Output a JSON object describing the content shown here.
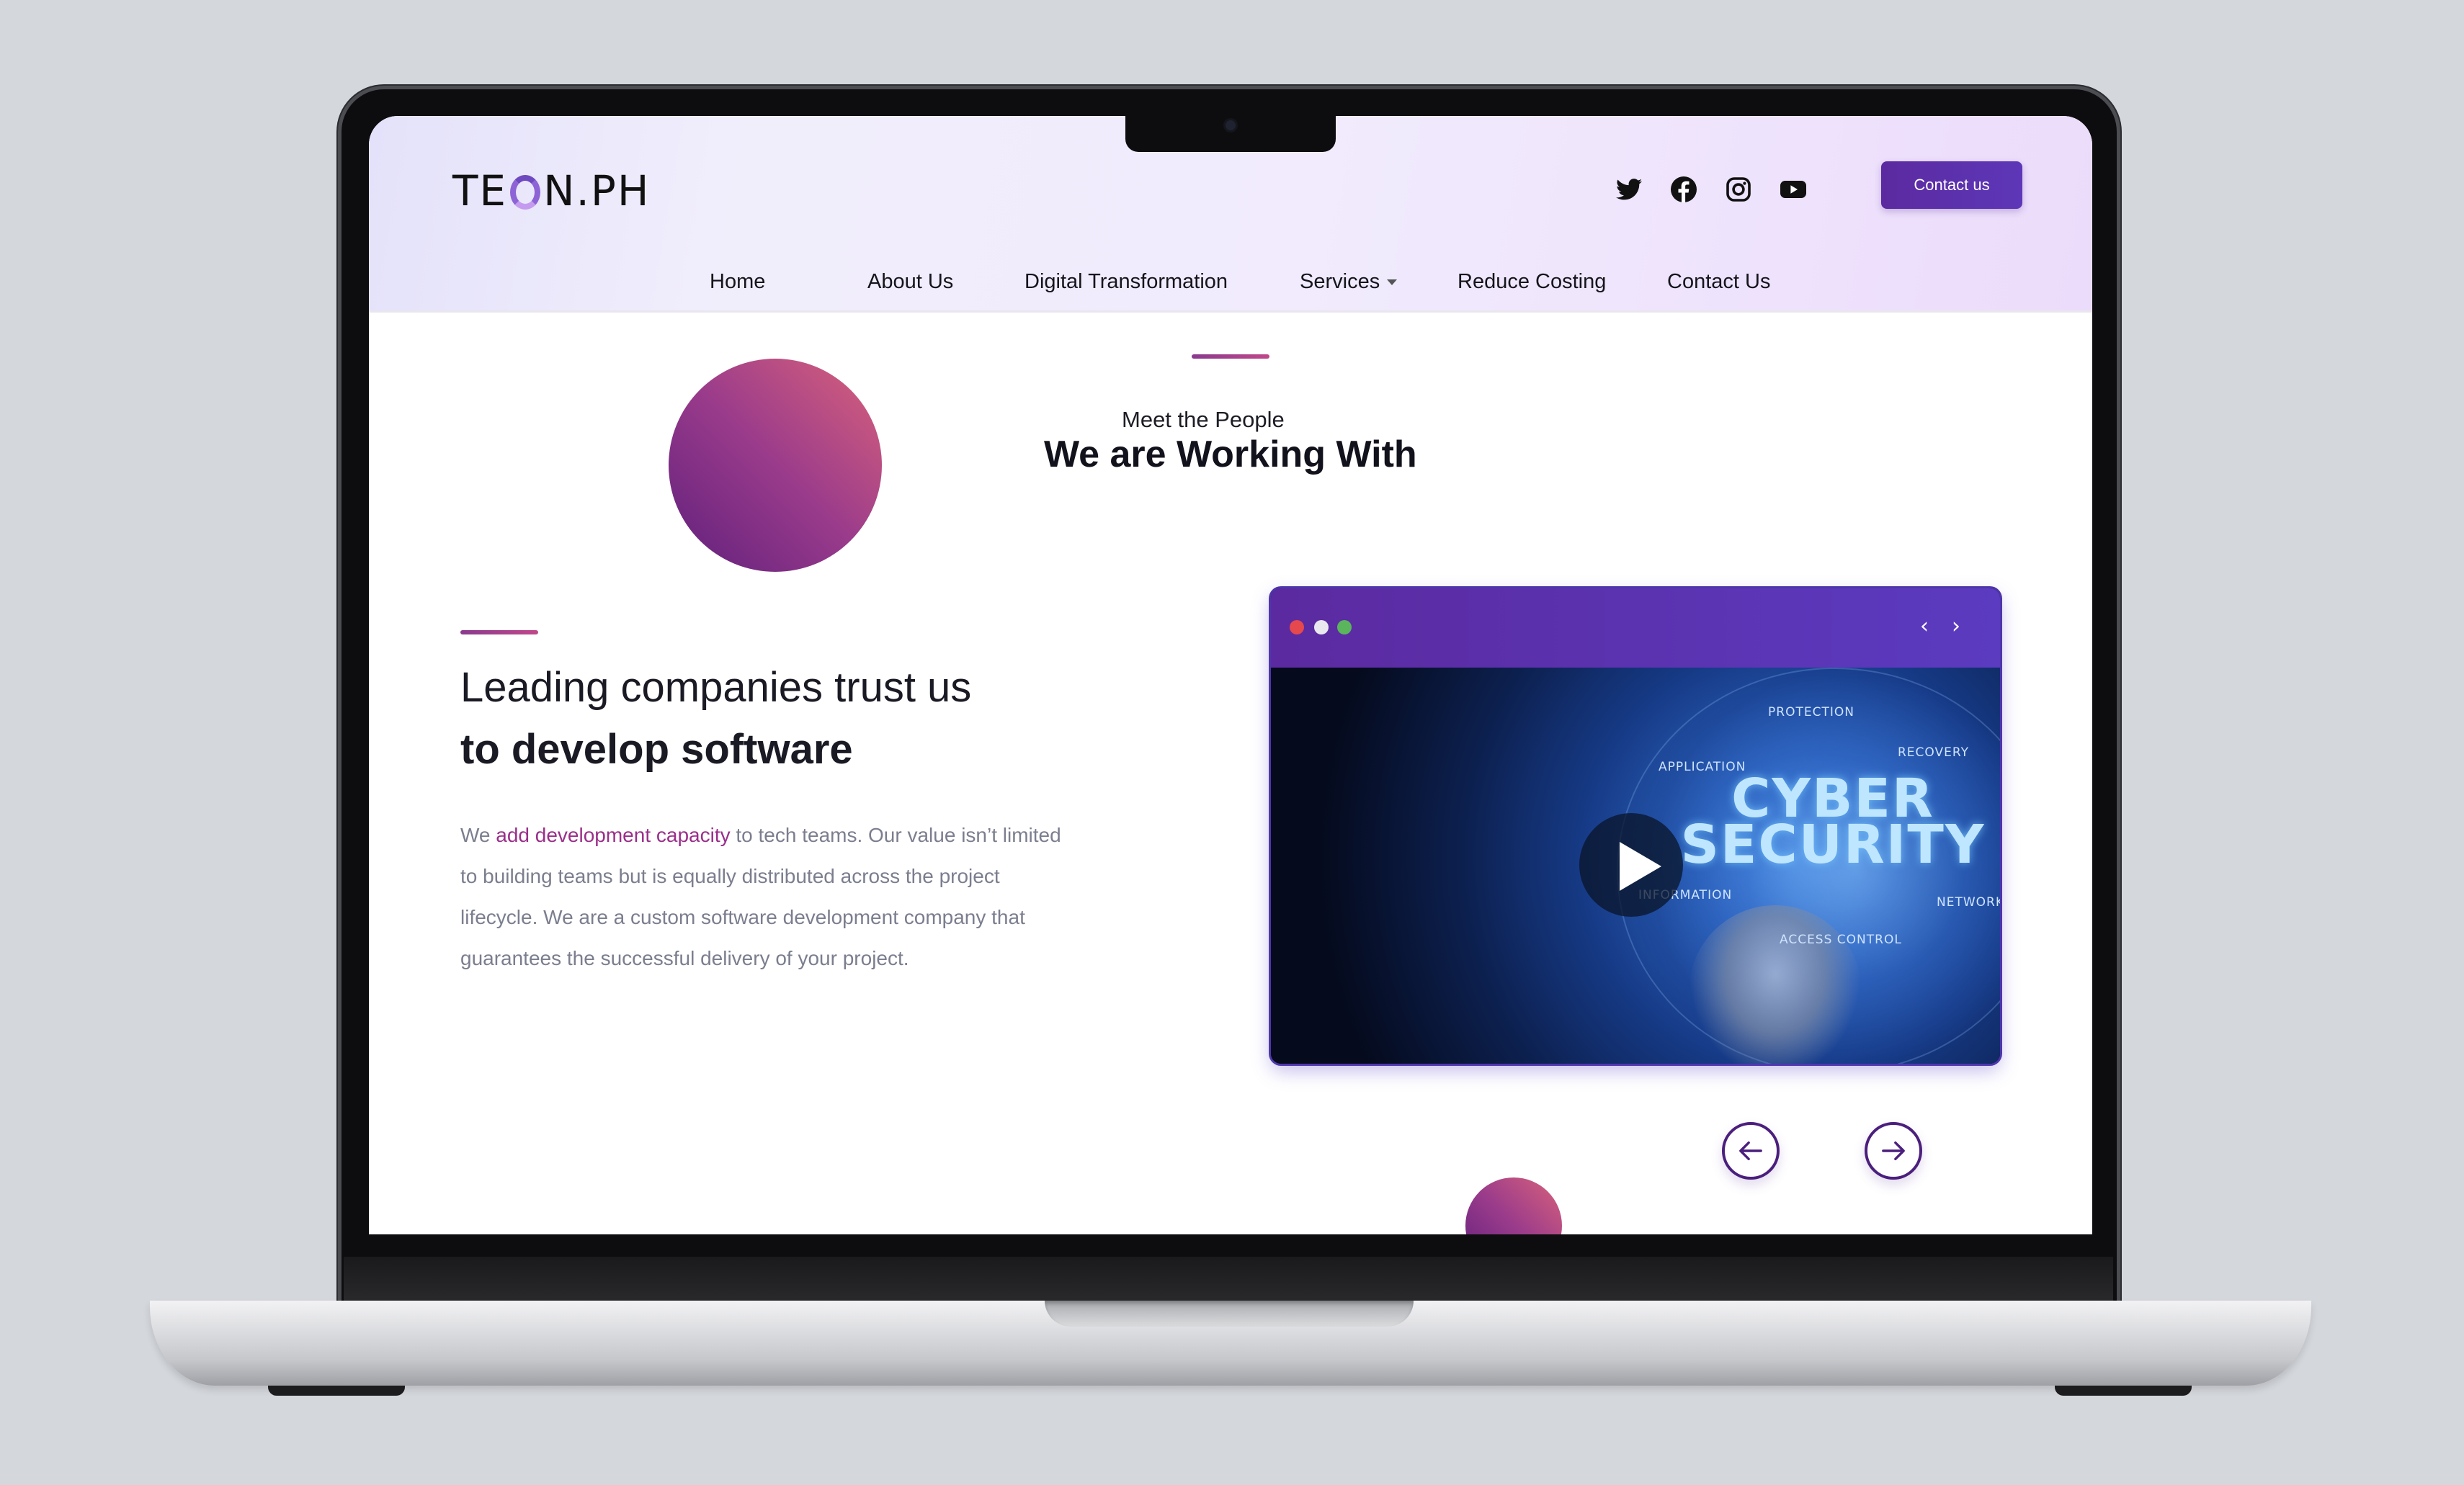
{
  "brand": {
    "logo_prefix": "TE",
    "logo_suffix": "N.PH",
    "logo_ring_color": "#8d63d6"
  },
  "header": {
    "social_icons": [
      "twitter-icon",
      "facebook-icon",
      "instagram-icon",
      "youtube-icon"
    ],
    "contact_button": "Contact us"
  },
  "nav": {
    "items": [
      {
        "label": "Home",
        "active": true
      },
      {
        "label": "About Us"
      },
      {
        "label": "Digital Transformation"
      },
      {
        "label": "Services",
        "has_dropdown": true
      },
      {
        "label": "Reduce Costing"
      },
      {
        "label": "Contact Us"
      }
    ]
  },
  "intro": {
    "kicker": "Meet the People",
    "title": "We are Working With"
  },
  "trust": {
    "line1": "Leading companies trust us",
    "line2": "to develop software",
    "para_before": "We ",
    "para_highlight": "add development capacity",
    "para_after": " to tech teams. Our value isn’t limited to building teams but is equally distributed across the project lifecycle. We are a custom software development company that guarantees the successful delivery of your project."
  },
  "video_card": {
    "window_dots": [
      "#e5484d",
      "#e8e8ee",
      "#5ab55c"
    ],
    "prev_arrow": "‹",
    "next_arrow": "›",
    "thumbnail_title_line1": "CYBER",
    "thumbnail_title_line2": "SECURITY",
    "tags": {
      "protection": "PROTECTION",
      "recovery": "RECOVERY",
      "application": "APPLICATION",
      "information": "INFORMATION",
      "network": "NETWORK",
      "access_control": "ACCESS CONTROL"
    },
    "play_icon": "play-icon"
  },
  "carousel": {
    "prev_icon": "arrow-left-icon",
    "next_icon": "arrow-right-icon"
  },
  "colors": {
    "accent_purple": "#5b2aa0",
    "accent_pink": "#c0488a",
    "text_gray": "#7b7e8e"
  }
}
